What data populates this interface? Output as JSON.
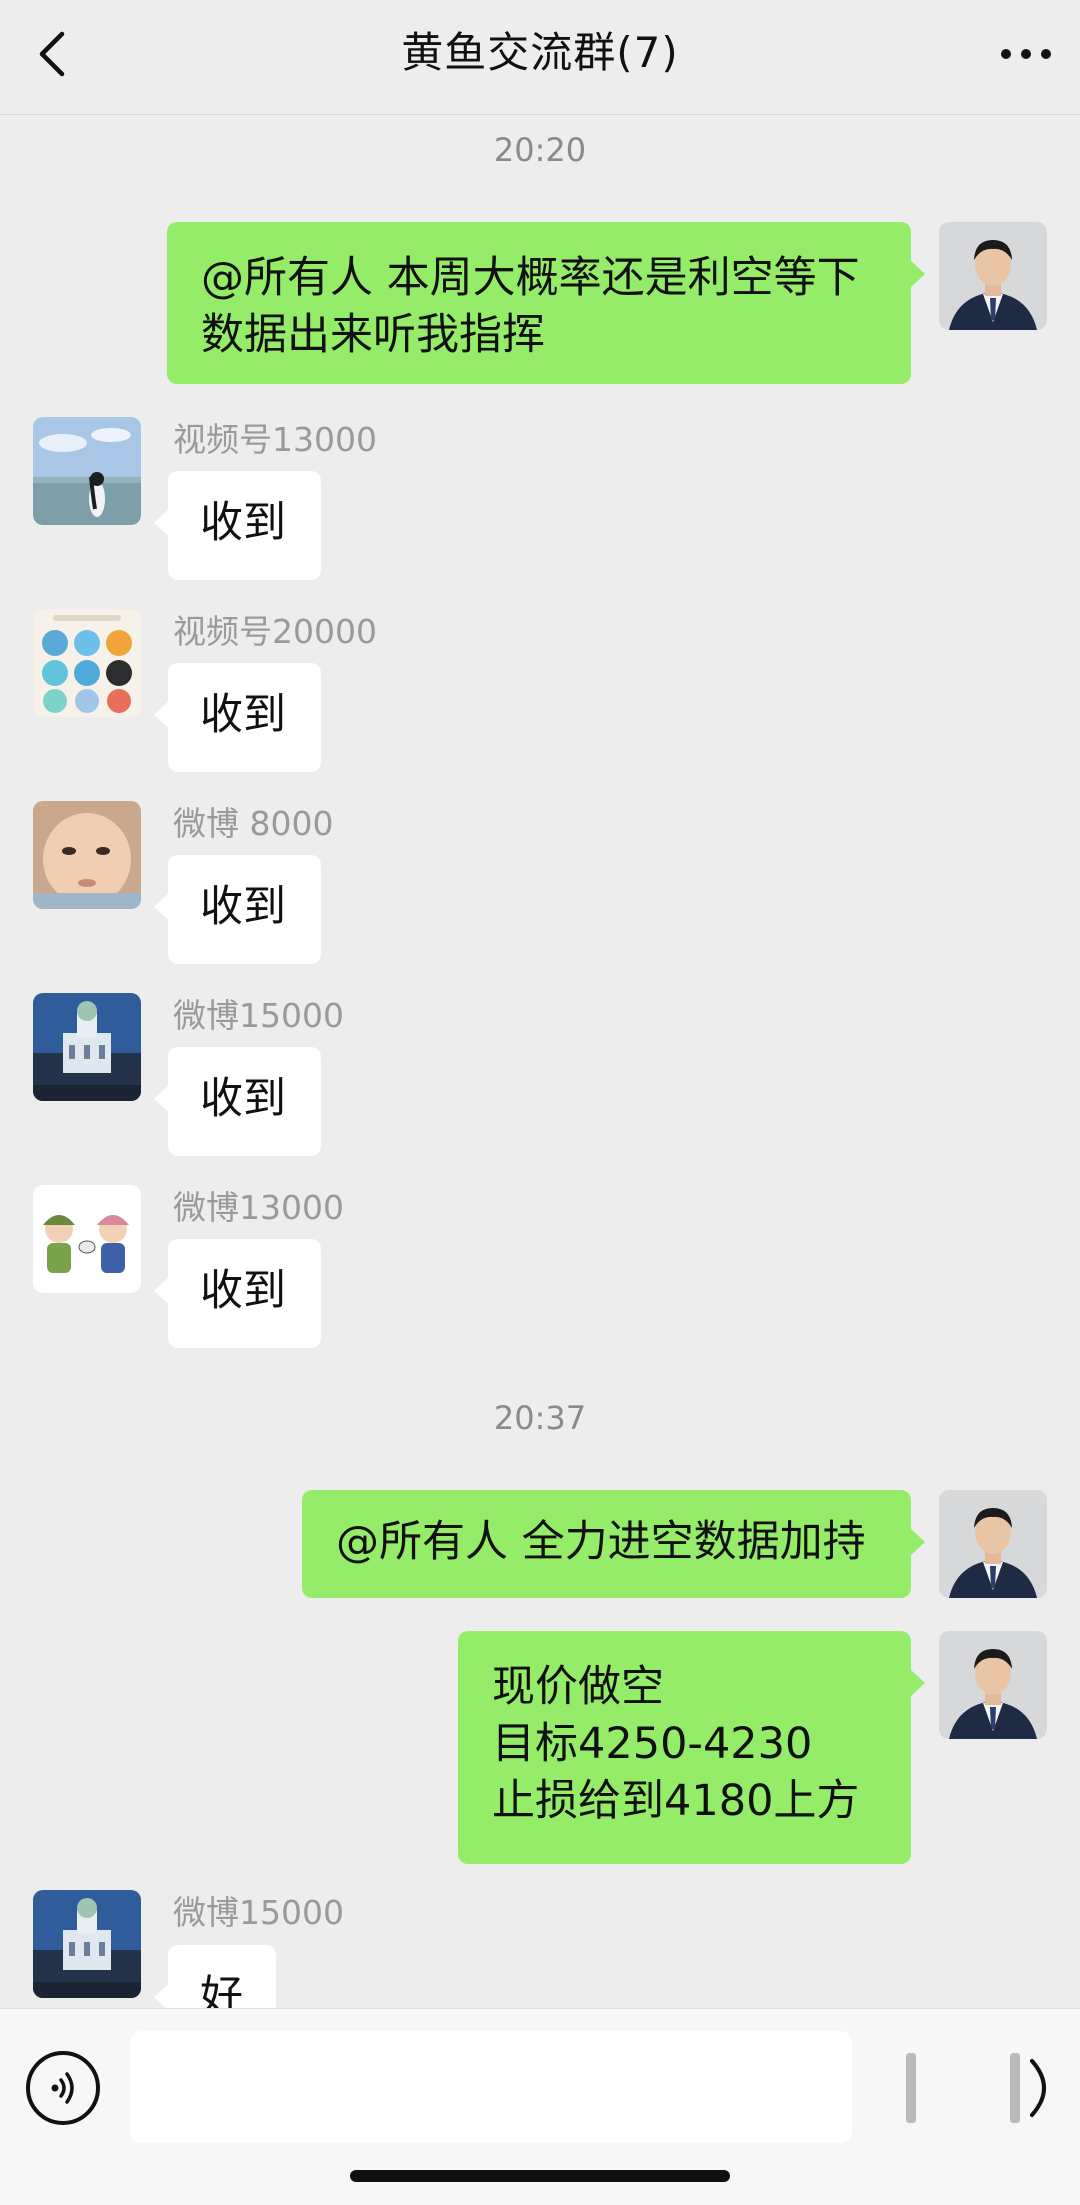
{
  "header": {
    "title": "黄鱼交流群(7)"
  },
  "messages": [
    {
      "type": "time",
      "text": "20:20"
    },
    {
      "type": "out",
      "text": "@所有人 本周大概率还是利空等下\n数据出来听我指挥"
    },
    {
      "type": "in",
      "sender": "视频号13000",
      "text": "收到"
    },
    {
      "type": "in",
      "sender": "视频号20000",
      "text": "收到"
    },
    {
      "type": "in",
      "sender": "微博 8000",
      "text": "收到"
    },
    {
      "type": "in",
      "sender": "微博15000",
      "text": "收到"
    },
    {
      "type": "in",
      "sender": "微博13000",
      "text": "收到"
    },
    {
      "type": "time",
      "text": "20:37"
    },
    {
      "type": "out",
      "text": "@所有人 全力进空数据加持"
    },
    {
      "type": "out",
      "text": "现价做空\n目标4250-4230\n止损给到4180上方"
    },
    {
      "type": "in",
      "sender": "微博15000",
      "text": "好"
    }
  ],
  "input": {
    "value": "",
    "placeholder": ""
  },
  "icons": {
    "back": "chevron-left-icon",
    "more": "more-dots-icon",
    "voice": "voice-icon"
  },
  "colors": {
    "outgoing_bubble": "#95ec69",
    "incoming_bubble": "#ffffff",
    "background": "#ededed"
  }
}
